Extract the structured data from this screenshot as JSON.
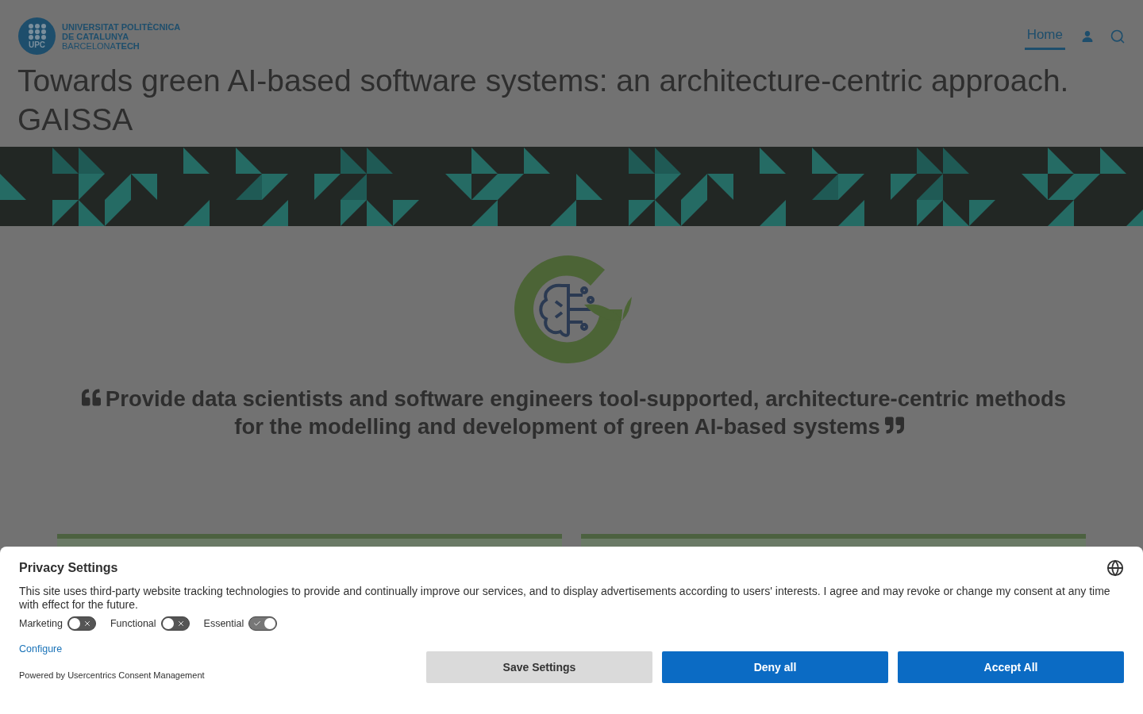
{
  "header": {
    "logo": {
      "badge": "UPC",
      "lines": [
        "UNIVERSITAT POLITÈCNICA",
        "DE CATALUNYA"
      ],
      "city": "BARCELONA",
      "city_bold": "TECH"
    },
    "nav": [
      {
        "label": "Home",
        "selected": true
      }
    ]
  },
  "page_title": "Towards green AI-based software systems: an architecture-centric approach. GAISSA",
  "quote": "Provide data scientists and software engineers tool-supported, architecture-centric methods for the modelling and development of green AI-based systems",
  "cards": [
    {
      "kind": "card"
    },
    {
      "kind": "card"
    }
  ],
  "consent": {
    "title": "Privacy Settings",
    "text": "This site uses third-party website tracking technologies to provide and continually improve our services, and to display advertisements according to users' interests. I agree and may revoke or change my consent at any time with effect for the future.",
    "toggles": [
      {
        "label": "Marketing",
        "on": false
      },
      {
        "label": "Functional",
        "on": false
      },
      {
        "label": "Essential",
        "on": true
      }
    ],
    "configure": "Configure",
    "powered_by": "Powered by Usercentrics Consent Management",
    "buttons": [
      {
        "label": "Save Settings",
        "kind": "secondary"
      },
      {
        "label": "Deny all",
        "kind": "primary"
      },
      {
        "label": "Accept All",
        "kind": "primary"
      }
    ]
  }
}
